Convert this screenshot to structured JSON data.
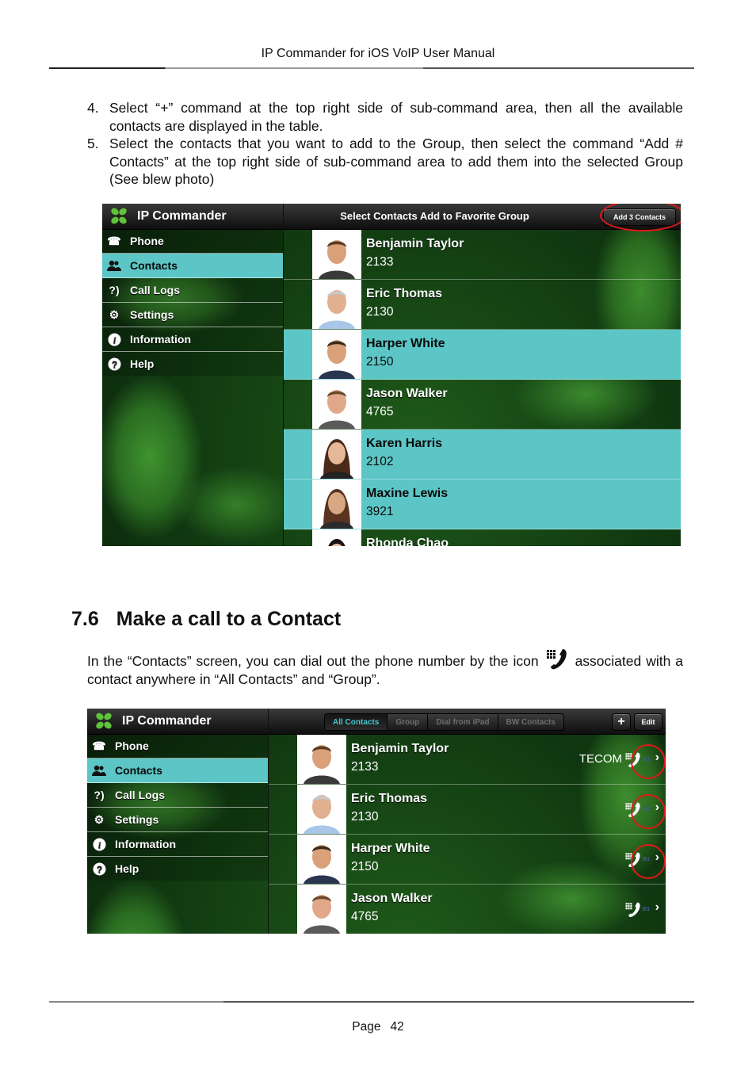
{
  "document": {
    "header_title": "IP Commander for iOS VoIP User Manual",
    "steps": [
      {
        "num": "4.",
        "text": "Select “+” command at the top right side of sub-command area, then all the available contacts are displayed in the table."
      },
      {
        "num": "5.",
        "text": "Select the contacts that you want to add to the Group, then select the command “Add # Contacts” at the top right side of sub-command area to add them into the selected Group (See blew photo)"
      }
    ],
    "section": {
      "number": "7.6",
      "title": "Make a call to a Contact"
    },
    "paragraph_before_icon": "In the “Contacts” screen, you can dial out the phone number by the icon",
    "paragraph_after_icon": "associated with a contact anywhere in “All Contacts” and “Group”.",
    "inline_icon": "dial-phone-keypad-icon",
    "footer": {
      "label": "Page",
      "number": "42"
    }
  },
  "app": {
    "brand": "IP Commander",
    "nav": [
      {
        "label": "Phone",
        "icon": "phone-icon",
        "selected": false
      },
      {
        "label": "Contacts",
        "icon": "contacts-icon",
        "selected": true
      },
      {
        "label": "Call Logs",
        "icon": "call-logs-icon",
        "selected": false
      },
      {
        "label": "Settings",
        "icon": "settings-gear-icon",
        "selected": false
      },
      {
        "label": "Information",
        "icon": "info-icon",
        "selected": false
      },
      {
        "label": "Help",
        "icon": "help-icon",
        "selected": false
      }
    ],
    "highlight_color": "#5cc6c6",
    "annotation_color": "#e01818"
  },
  "screen1": {
    "title": "Select Contacts Add to Favorite Group",
    "add_button": "Add 3 Contacts",
    "contacts": [
      {
        "name": "Benjamin Taylor",
        "number": "2133",
        "selected": false
      },
      {
        "name": "Eric Thomas",
        "number": "2130",
        "selected": false
      },
      {
        "name": "Harper White",
        "number": "2150",
        "selected": true
      },
      {
        "name": "Jason Walker",
        "number": "4765",
        "selected": false
      },
      {
        "name": "Karen Harris",
        "number": "2102",
        "selected": true
      },
      {
        "name": "Maxine Lewis",
        "number": "3921",
        "selected": true
      },
      {
        "name": "Rhonda Chao",
        "number": "",
        "selected": false
      }
    ]
  },
  "screen2": {
    "tabs": [
      {
        "label": "All Contacts",
        "active": true
      },
      {
        "label": "Group",
        "active": false
      },
      {
        "label": "Dial from iPad",
        "active": false
      },
      {
        "label": "BW Contacts",
        "active": false
      }
    ],
    "plus_button": "+",
    "edit_button": "Edit",
    "badge": "B1",
    "contacts": [
      {
        "name": "Benjamin Taylor",
        "number": "2133",
        "label": "TECOM",
        "circled": true
      },
      {
        "name": "Eric Thomas",
        "number": "2130",
        "label": "",
        "circled": true
      },
      {
        "name": "Harper White",
        "number": "2150",
        "label": "",
        "circled": true
      },
      {
        "name": "Jason Walker",
        "number": "4765",
        "label": "",
        "circled": false
      }
    ]
  }
}
